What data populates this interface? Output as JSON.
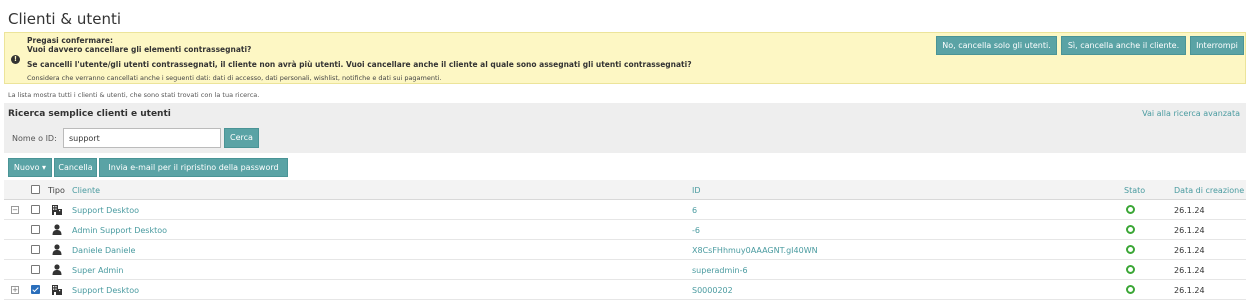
{
  "page": {
    "title": "Clienti & utenti"
  },
  "alert": {
    "line1": "Pregasi confermare:",
    "line2": "Vuoi davvero cancellare gli elementi contrassegnati?",
    "line3": "Se cancelli l'utente/gli utenti contrassegnati, il cliente non avrà più utenti. Vuoi cancellare anche il cliente al quale sono assegnati gli utenti contrassegnati?",
    "line4": "Considera che verranno cancellati anche i seguenti dati: dati di accesso, dati personali, wishlist, notifiche e dati sui pagamenti.",
    "btn_no": "No, cancella solo gli utenti.",
    "btn_si": "Sì, cancella anche il cliente.",
    "btn_interrompi": "Interrompi"
  },
  "info": "La lista mostra tutti i clienti & utenti, che sono stati trovati con la tua ricerca.",
  "search": {
    "title": "Ricerca semplice clienti e utenti",
    "advanced_link": "Vai alla ricerca avanzata",
    "label": "Nome o ID:",
    "value": "support",
    "button": "Cerca"
  },
  "actions": {
    "nuovo": "Nuovo ▾",
    "cancella": "Cancella",
    "invia": "Invia e-mail per il ripristino della password"
  },
  "table": {
    "headers": {
      "tipo": "Tipo",
      "cliente": "Cliente",
      "id": "ID",
      "stato": "Stato",
      "data": "Data di creazione"
    },
    "rows": [
      {
        "expander": "−",
        "checked": false,
        "type": "company",
        "cliente": "Support Desktoo",
        "id": "6",
        "stato": "active",
        "data": "26.1.24"
      },
      {
        "expander": "",
        "checked": false,
        "type": "user",
        "cliente": "Admin Support Desktoo",
        "id": "-6",
        "stato": "active",
        "data": "26.1.24"
      },
      {
        "expander": "",
        "checked": false,
        "type": "user",
        "cliente": "Daniele Daniele",
        "id": "X8CsFHhmuy0AAAGNT.gI40WN",
        "stato": "active",
        "data": "26.1.24"
      },
      {
        "expander": "",
        "checked": false,
        "type": "user",
        "cliente": "Super Admin",
        "id": "superadmin-6",
        "stato": "active",
        "data": "26.1.24"
      },
      {
        "expander": "+",
        "checked": true,
        "type": "company",
        "cliente": "Support Desktoo",
        "id": "S0000202",
        "stato": "active",
        "data": "26.1.24"
      }
    ]
  },
  "colors": {
    "accent": "#5aa3a5",
    "link": "#4a9ba0",
    "alert_bg": "#fdf7c4",
    "status_active": "#3aa635"
  }
}
